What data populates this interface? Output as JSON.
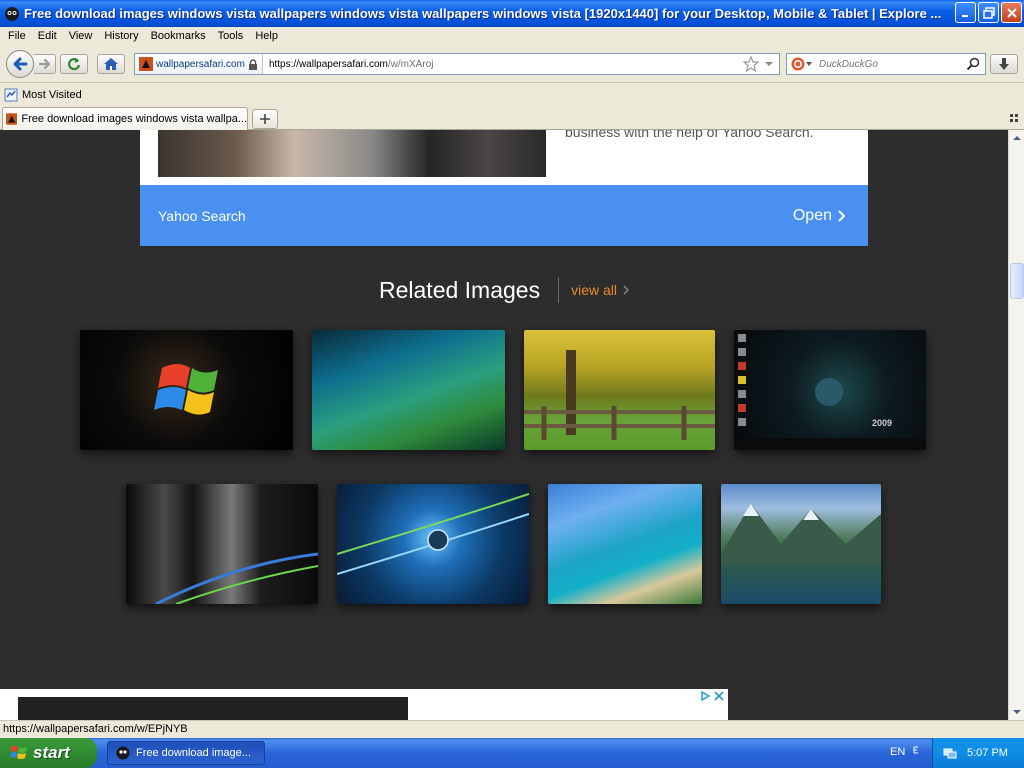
{
  "window": {
    "title": "Free download images windows vista wallpapers windows vista wallpapers windows vista [1920x1440] for your Desktop, Mobile & Tablet | Explore ..."
  },
  "menu": {
    "items": [
      "File",
      "Edit",
      "View",
      "History",
      "Bookmarks",
      "Tools",
      "Help"
    ]
  },
  "nav": {
    "identity": "wallpapersafari.com",
    "url_host": "https://wallpapersafari.com",
    "url_path": "/w/mXAroj",
    "search_placeholder": "DuckDuckGo"
  },
  "bookmarks": {
    "most_visited": "Most Visited"
  },
  "tabs": [
    {
      "label": "Free download images windows vista wallpa..."
    }
  ],
  "ad_top": {
    "description": "business with the help of Yahoo Search.",
    "brand": "Yahoo Search",
    "cta": "Open"
  },
  "related": {
    "title": "Related Images",
    "view_all": "view all"
  },
  "thumbnails": [
    {
      "caption": ""
    },
    {
      "caption": ""
    },
    {
      "caption": ""
    },
    {
      "caption": "2009"
    },
    {
      "caption": ""
    },
    {
      "caption": ""
    },
    {
      "caption": ""
    },
    {
      "caption": ""
    }
  ],
  "status": {
    "text": "https://wallpapersafari.com/w/EPjNYB"
  },
  "taskbar": {
    "start": "start",
    "task": "Free download image...",
    "lang": "EN",
    "clock": "5:07 PM"
  },
  "colors": {
    "accent": "#4a90f0",
    "view_all": "#e88a2c",
    "page_bg": "#2d2d2d"
  }
}
